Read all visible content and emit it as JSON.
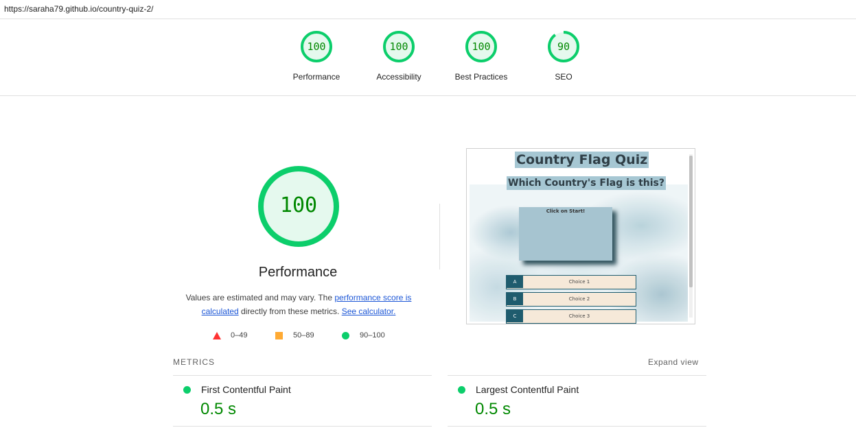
{
  "url": "https://saraha79.github.io/country-quiz-2/",
  "gauges": [
    {
      "score": "100",
      "label": "Performance",
      "fraction": 1.0,
      "color": "#0cce6b"
    },
    {
      "score": "100",
      "label": "Accessibility",
      "fraction": 1.0,
      "color": "#0cce6b"
    },
    {
      "score": "100",
      "label": "Best Practices",
      "fraction": 1.0,
      "color": "#0cce6b"
    },
    {
      "score": "90",
      "label": "SEO",
      "fraction": 0.9,
      "color": "#0cce6b"
    }
  ],
  "performance": {
    "score": "100",
    "title": "Performance",
    "desc_prefix": "Values are estimated and may vary. The ",
    "link1": "performance score is calculated",
    "desc_middle": " directly from these metrics. ",
    "link2": "See calculator."
  },
  "legend": [
    {
      "shape": "triangle",
      "range": "0–49",
      "color": "#ff3333"
    },
    {
      "shape": "square",
      "range": "50–89",
      "color": "#ffaa33"
    },
    {
      "shape": "circle",
      "range": "90–100",
      "color": "#0cce6b"
    }
  ],
  "screenshot": {
    "title": "Country Flag Quiz",
    "subtitle": "Which Country's Flag is this?",
    "prompt": "Click on Start!",
    "choices": [
      {
        "key": "A",
        "label": "Choice 1"
      },
      {
        "key": "B",
        "label": "Choice 2"
      },
      {
        "key": "C",
        "label": "Choice 3"
      }
    ]
  },
  "metrics": {
    "header": "METRICS",
    "expand": "Expand view",
    "items": [
      {
        "title": "First Contentful Paint",
        "value": "0.5 s",
        "status": "good"
      },
      {
        "title": "Largest Contentful Paint",
        "value": "0.5 s",
        "status": "good"
      }
    ]
  },
  "colors": {
    "pass": "#0cce6b",
    "pass_text": "#008800",
    "link": "#1a55d6"
  }
}
